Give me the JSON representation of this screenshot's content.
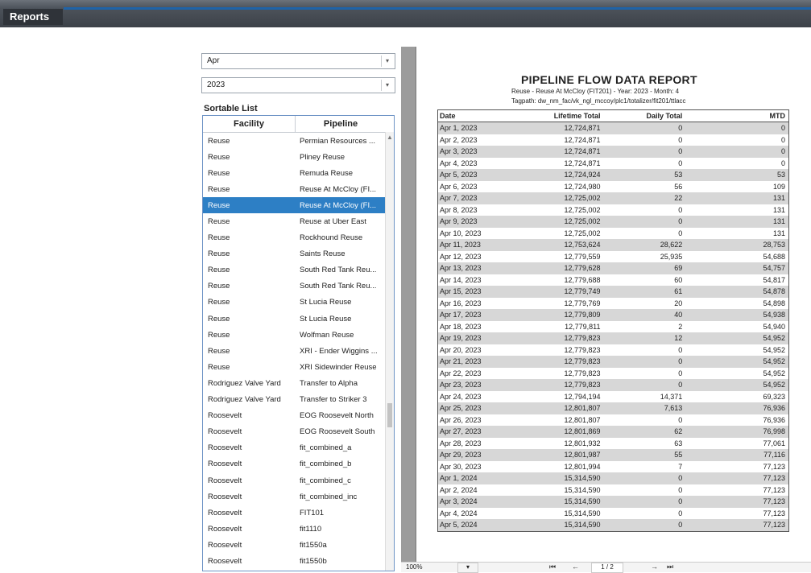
{
  "header": {
    "tab_label": "Reports"
  },
  "filters": {
    "month": "Apr",
    "year": "2023",
    "dropdown_icon": "▾"
  },
  "sortable_list": {
    "label": "Sortable List",
    "columns": [
      "Facility",
      "Pipeline"
    ],
    "rows": [
      [
        "Reuse",
        "Permian Resources ..."
      ],
      [
        "Reuse",
        "Pliney Reuse"
      ],
      [
        "Reuse",
        "Remuda Reuse"
      ],
      [
        "Reuse",
        "Reuse At McCloy (FI..."
      ],
      [
        "Reuse",
        "Reuse At McCloy (FI..."
      ],
      [
        "Reuse",
        "Reuse at Uber East"
      ],
      [
        "Reuse",
        "Rockhound Reuse"
      ],
      [
        "Reuse",
        "Saints Reuse"
      ],
      [
        "Reuse",
        "South Red Tank Reu..."
      ],
      [
        "Reuse",
        "South Red Tank Reu..."
      ],
      [
        "Reuse",
        "St Lucia Reuse"
      ],
      [
        "Reuse",
        "St Lucia Reuse"
      ],
      [
        "Reuse",
        "Wolfman Reuse"
      ],
      [
        "Reuse",
        "XRI - Ender Wiggins ..."
      ],
      [
        "Reuse",
        "XRI Sidewinder Reuse"
      ],
      [
        "Rodriguez Valve Yard",
        "Transfer to Alpha"
      ],
      [
        "Rodriguez Valve Yard",
        "Transfer to Striker 3"
      ],
      [
        "Roosevelt",
        "EOG Roosevelt North"
      ],
      [
        "Roosevelt",
        "EOG Roosevelt South"
      ],
      [
        "Roosevelt",
        "fit_combined_a"
      ],
      [
        "Roosevelt",
        "fit_combined_b"
      ],
      [
        "Roosevelt",
        "fit_combined_c"
      ],
      [
        "Roosevelt",
        "fit_combined_inc"
      ],
      [
        "Roosevelt",
        "FIT101"
      ],
      [
        "Roosevelt",
        "fit1110"
      ],
      [
        "Roosevelt",
        "fit1550a"
      ],
      [
        "Roosevelt",
        "fit1550b"
      ]
    ],
    "selected_index": 4
  },
  "report": {
    "title": "PIPELINE FLOW DATA REPORT",
    "subtitle": "Reuse - Reuse At McCloy (FIT201) - Year: 2023 - Month: 4",
    "tagpath": "Tagpath: dw_nm_fac/vk_ngl_mccoy/plc1/totalizer/fit201/ttlacc",
    "columns": [
      "Date",
      "Lifetime Total",
      "Daily Total",
      "MTD"
    ],
    "rows": [
      [
        "Apr 1, 2023",
        "12,724,871",
        "0",
        "0"
      ],
      [
        "Apr 2, 2023",
        "12,724,871",
        "0",
        "0"
      ],
      [
        "Apr 3, 2023",
        "12,724,871",
        "0",
        "0"
      ],
      [
        "Apr 4, 2023",
        "12,724,871",
        "0",
        "0"
      ],
      [
        "Apr 5, 2023",
        "12,724,924",
        "53",
        "53"
      ],
      [
        "Apr 6, 2023",
        "12,724,980",
        "56",
        "109"
      ],
      [
        "Apr 7, 2023",
        "12,725,002",
        "22",
        "131"
      ],
      [
        "Apr 8, 2023",
        "12,725,002",
        "0",
        "131"
      ],
      [
        "Apr 9, 2023",
        "12,725,002",
        "0",
        "131"
      ],
      [
        "Apr 10, 2023",
        "12,725,002",
        "0",
        "131"
      ],
      [
        "Apr 11, 2023",
        "12,753,624",
        "28,622",
        "28,753"
      ],
      [
        "Apr 12, 2023",
        "12,779,559",
        "25,935",
        "54,688"
      ],
      [
        "Apr 13, 2023",
        "12,779,628",
        "69",
        "54,757"
      ],
      [
        "Apr 14, 2023",
        "12,779,688",
        "60",
        "54,817"
      ],
      [
        "Apr 15, 2023",
        "12,779,749",
        "61",
        "54,878"
      ],
      [
        "Apr 16, 2023",
        "12,779,769",
        "20",
        "54,898"
      ],
      [
        "Apr 17, 2023",
        "12,779,809",
        "40",
        "54,938"
      ],
      [
        "Apr 18, 2023",
        "12,779,811",
        "2",
        "54,940"
      ],
      [
        "Apr 19, 2023",
        "12,779,823",
        "12",
        "54,952"
      ],
      [
        "Apr 20, 2023",
        "12,779,823",
        "0",
        "54,952"
      ],
      [
        "Apr 21, 2023",
        "12,779,823",
        "0",
        "54,952"
      ],
      [
        "Apr 22, 2023",
        "12,779,823",
        "0",
        "54,952"
      ],
      [
        "Apr 23, 2023",
        "12,779,823",
        "0",
        "54,952"
      ],
      [
        "Apr 24, 2023",
        "12,794,194",
        "14,371",
        "69,323"
      ],
      [
        "Apr 25, 2023",
        "12,801,807",
        "7,613",
        "76,936"
      ],
      [
        "Apr 26, 2023",
        "12,801,807",
        "0",
        "76,936"
      ],
      [
        "Apr 27, 2023",
        "12,801,869",
        "62",
        "76,998"
      ],
      [
        "Apr 28, 2023",
        "12,801,932",
        "63",
        "77,061"
      ],
      [
        "Apr 29, 2023",
        "12,801,987",
        "55",
        "77,116"
      ],
      [
        "Apr 30, 2023",
        "12,801,994",
        "7",
        "77,123"
      ],
      [
        "Apr 1, 2024",
        "15,314,590",
        "0",
        "77,123"
      ],
      [
        "Apr 2, 2024",
        "15,314,590",
        "0",
        "77,123"
      ],
      [
        "Apr 3, 2024",
        "15,314,590",
        "0",
        "77,123"
      ],
      [
        "Apr 4, 2024",
        "15,314,590",
        "0",
        "77,123"
      ],
      [
        "Apr 5, 2024",
        "15,314,590",
        "0",
        "77,123"
      ]
    ]
  },
  "pager": {
    "zoom": "100%",
    "page": "1 / 2",
    "first_icon": "⏮",
    "prev_icon": "←",
    "next_icon": "→",
    "last_icon": "⏭"
  }
}
